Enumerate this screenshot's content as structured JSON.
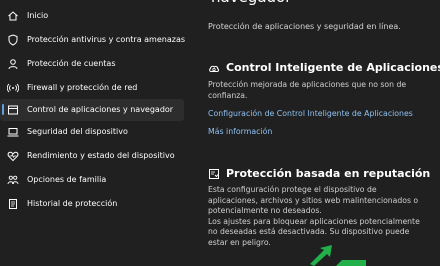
{
  "sidebar": {
    "items": [
      {
        "label": "Inicio",
        "icon": "home-icon"
      },
      {
        "label": "Protección antivirus y contra amenazas",
        "icon": "shield-icon"
      },
      {
        "label": "Protección de cuentas",
        "icon": "person-icon"
      },
      {
        "label": "Firewall y protección de red",
        "icon": "wifi-icon"
      },
      {
        "label": "Control de aplicaciones y navegador",
        "icon": "app-window-icon",
        "selected": true
      },
      {
        "label": "Seguridad del dispositivo",
        "icon": "laptop-icon"
      },
      {
        "label": "Rendimiento y estado del dispositivo",
        "icon": "heart-icon"
      },
      {
        "label": "Opciones de familia",
        "icon": "family-icon"
      },
      {
        "label": "Historial de protección",
        "icon": "history-icon"
      }
    ]
  },
  "main": {
    "title": "navegador",
    "subtitle": "Protección de aplicaciones y seguridad en línea.",
    "smart_control": {
      "icon": "cloud-sync-icon",
      "title": "Control Inteligente de Aplicaciones",
      "description_lines": [
        "Protección mejorada de aplicaciones que no son de",
        "confianza."
      ],
      "settings_link": "Configuración de Control Inteligente de Aplicaciones",
      "more_info_link": "Más información"
    },
    "reputation": {
      "icon": "reputation-icon",
      "title": "Protección basada en reputación",
      "description_lines": [
        "Esta configuración protege el dispositivo de",
        "aplicaciones, archivos y sitios web malintencionados o",
        "potencialmente no deseados.",
        "Los ajustes para bloquear aplicaciones potencialmente",
        "no deseadas está desactivada. Su dispositivo puede",
        "estar en peligro."
      ]
    }
  },
  "colors": {
    "background": "#202020",
    "selected_bg": "#2d2d2d",
    "accent": "#5ea0e0",
    "link": "#8fc2f2",
    "annotation_arrow": "#22b04a"
  }
}
